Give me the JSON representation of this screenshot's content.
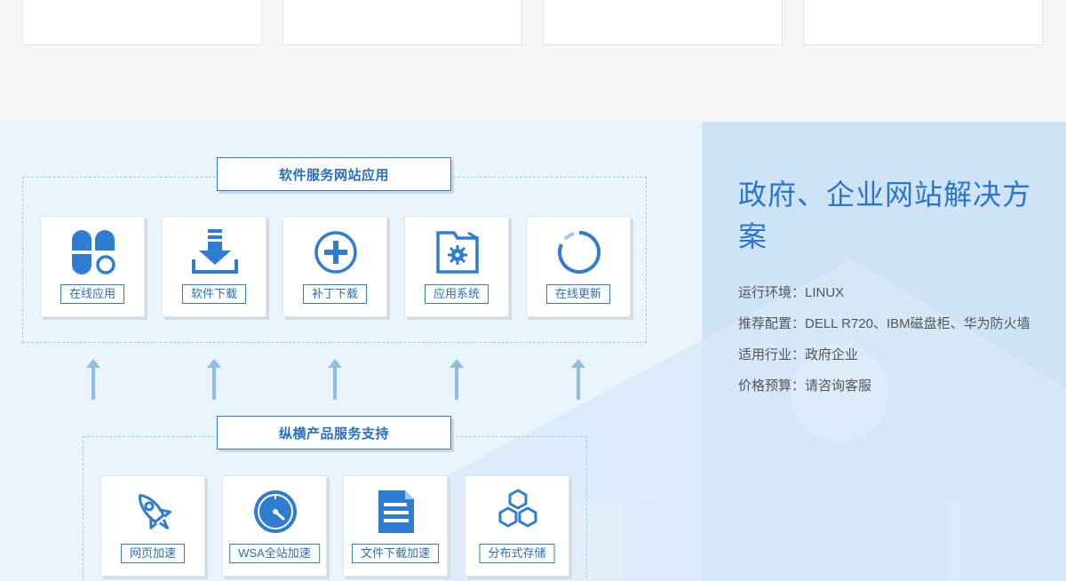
{
  "software_group": {
    "title": "软件服务网站应用",
    "items": [
      {
        "label": "在线应用",
        "icon": "clover-icon"
      },
      {
        "label": "软件下载",
        "icon": "download-icon"
      },
      {
        "label": "补丁下载",
        "icon": "plus-circle-icon"
      },
      {
        "label": "应用系统",
        "icon": "folder-gear-icon"
      },
      {
        "label": "在线更新",
        "icon": "refresh-ring-icon"
      }
    ]
  },
  "support_group": {
    "title": "纵横产品服务支持",
    "items": [
      {
        "label": "网页加速",
        "icon": "rocket-icon"
      },
      {
        "label": "WSA全站加速",
        "icon": "speedometer-icon"
      },
      {
        "label": "文件下载加速",
        "icon": "document-icon"
      },
      {
        "label": "分布式存储",
        "icon": "hexagons-icon"
      }
    ]
  },
  "solution": {
    "title": "政府、企业网站解决方案",
    "lines": [
      "运行环境：LINUX",
      "推荐配置：DELL R720、IBM磁盘柜、华为防火墙",
      "适用行业：政府企业",
      "价格预算：请咨询客服"
    ]
  },
  "colors": {
    "accent": "#2f7dd0",
    "band_left": "#eaf4fd",
    "band_right": "#cfe3f6",
    "arrow": "#8fbde6"
  }
}
